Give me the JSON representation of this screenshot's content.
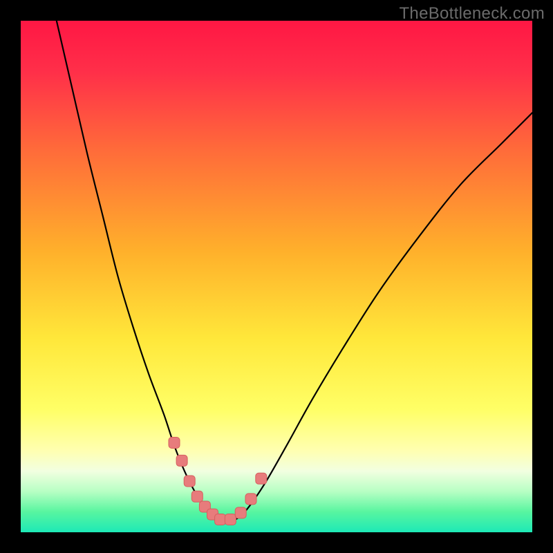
{
  "watermark": "TheBottleneck.com",
  "colors": {
    "frame": "#000000",
    "curve": "#000000",
    "marker_fill": "#e77c7c",
    "marker_stroke": "#d65e5e",
    "watermark": "#6b6b6b",
    "gradient_stops": [
      {
        "offset": 0.0,
        "color": "#ff1744"
      },
      {
        "offset": 0.1,
        "color": "#ff2f49"
      },
      {
        "offset": 0.25,
        "color": "#ff6a3a"
      },
      {
        "offset": 0.45,
        "color": "#ffb02b"
      },
      {
        "offset": 0.62,
        "color": "#ffe73a"
      },
      {
        "offset": 0.76,
        "color": "#ffff66"
      },
      {
        "offset": 0.84,
        "color": "#ffffb0"
      },
      {
        "offset": 0.88,
        "color": "#f2ffe0"
      },
      {
        "offset": 0.92,
        "color": "#b8ffc4"
      },
      {
        "offset": 0.96,
        "color": "#58f5a0"
      },
      {
        "offset": 1.0,
        "color": "#1de9b6"
      }
    ]
  },
  "chart_data": {
    "type": "line",
    "title": "",
    "xlabel": "",
    "ylabel": "",
    "xlim": [
      0,
      100
    ],
    "ylim": [
      0,
      100
    ],
    "grid": false,
    "note": "Axes are normalized 0–100 each (screenshot has no visible tick labels or axis titles). X is the position along the horizontal axis left→right, Y is the height above the bottom edge. Values estimated from pixel position.",
    "series": [
      {
        "name": "curve",
        "x": [
          7,
          10,
          13,
          16,
          19,
          22,
          25,
          28,
          30,
          32,
          34,
          36,
          37,
          38,
          39,
          41,
          43,
          45,
          48,
          52,
          57,
          63,
          70,
          78,
          86,
          94,
          100
        ],
        "y": [
          100,
          87,
          74,
          62,
          50,
          40,
          31,
          23,
          17,
          12,
          8,
          5,
          3.5,
          2.5,
          2,
          2.1,
          3.2,
          5.5,
          10,
          17,
          26,
          36,
          47,
          58,
          68,
          76,
          82
        ]
      }
    ],
    "markers": {
      "name": "highlighted-points",
      "x": [
        30,
        31.5,
        33,
        34.5,
        36,
        37.5,
        39,
        41,
        43,
        45,
        47
      ],
      "y": [
        17.5,
        14,
        10,
        7,
        5,
        3.5,
        2.5,
        2.5,
        3.8,
        6.5,
        10.5
      ],
      "size": 16
    }
  }
}
